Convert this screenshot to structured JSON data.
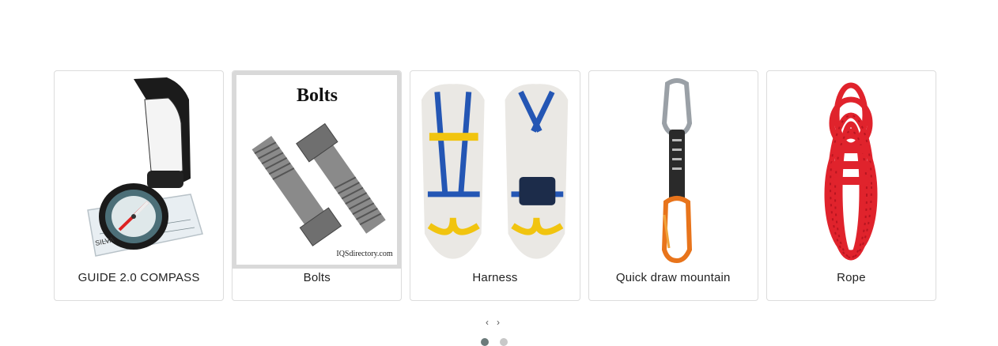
{
  "products": [
    {
      "label": "GUIDE 2.0 COMPASS",
      "icon": "compass-icon"
    },
    {
      "label": "Bolts",
      "icon": "bolts-icon",
      "image_text": "Bolts",
      "watermark": "IQSdirectory.com"
    },
    {
      "label": "Harness",
      "icon": "harness-icon"
    },
    {
      "label": "Quick draw mountain",
      "icon": "quickdraw-icon"
    },
    {
      "label": "Rope",
      "icon": "rope-icon"
    }
  ],
  "nav": {
    "prev": "‹",
    "next": "›"
  },
  "pagination": {
    "pages": 2,
    "active": 0
  }
}
